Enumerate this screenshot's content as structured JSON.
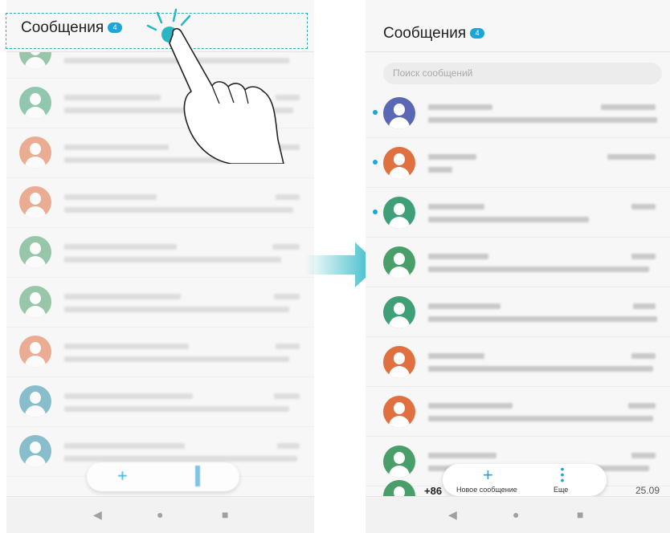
{
  "left_screen": {
    "title": "Сообщения",
    "badge": "4",
    "avatar_colors": [
      "#4a9e6a",
      "#3f9f76",
      "#e07040",
      "#e07040",
      "#4a9e6a",
      "#4a9e6a",
      "#e07040",
      "#2f8fa8",
      "#2f8fa8"
    ]
  },
  "right_screen": {
    "title": "Сообщения",
    "badge": "4",
    "search_placeholder": "Поиск сообщений",
    "avatar_colors": [
      "#5967b4",
      "#e07040",
      "#3f9f76",
      "#4a9e6a",
      "#3f9f76",
      "#e07040",
      "#e07040",
      "#4a9e6a",
      "#4a9e6a"
    ],
    "unread_rows": [
      0,
      1,
      2
    ],
    "last_row_sender_prefix": "+86",
    "last_row_date": "25.09",
    "action_bar": {
      "new_message_label": "Новое сообщение",
      "more_label": "Еще",
      "new_icon": "plus-icon",
      "more_icon": "vertical-dots-icon"
    }
  },
  "gesture": {
    "icon": "hand-tap-icon",
    "arrow_color": "#2bb6c4"
  },
  "nav_icons": [
    "back-icon",
    "home-icon",
    "recent-icon"
  ]
}
